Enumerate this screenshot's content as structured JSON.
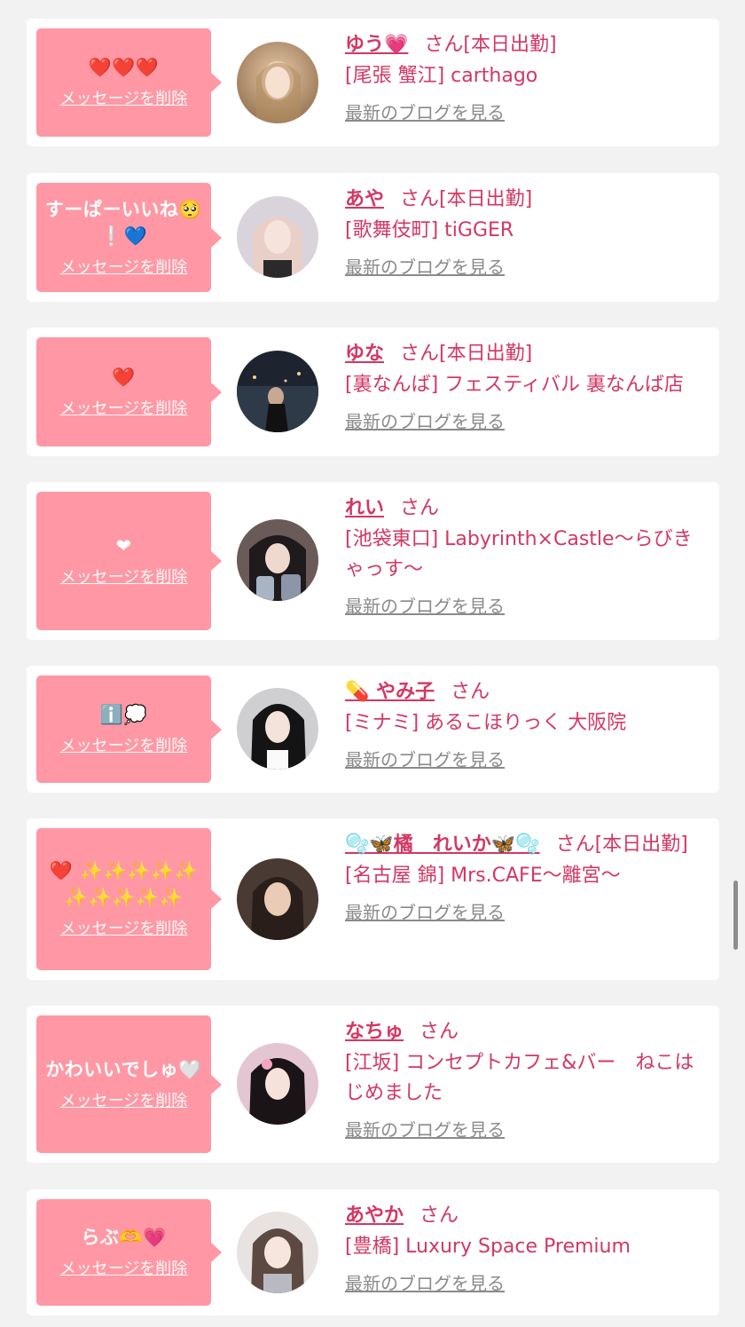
{
  "cards": [
    {
      "message": "❤️❤️❤️",
      "delete_label": "メッセージを削除",
      "name": "ゆう💗",
      "san": "さん",
      "status": "[本日出勤]",
      "shop": "[尾張 蟹江] carthago",
      "blog_label": "最新のブログを見る"
    },
    {
      "message": "すーぱーいいね🥺❕💙",
      "delete_label": "メッセージを削除",
      "name": "あや",
      "san": "さん",
      "status": "[本日出勤]",
      "shop": "[歌舞伎町] tiGGER",
      "blog_label": "最新のブログを見る"
    },
    {
      "message": "❤️",
      "delete_label": "メッセージを削除",
      "name": "ゆな",
      "san": "さん",
      "status": "[本日出勤]",
      "shop": "[裏なんば] フェスティバル 裏なんば店",
      "blog_label": "最新のブログを見る"
    },
    {
      "message": "❤",
      "delete_label": "メッセージを削除",
      "name": "れい",
      "san": "さん",
      "status": "",
      "shop": "[池袋東口] Labyrinth×Castle〜らびきゃっす〜",
      "blog_label": "最新のブログを見る"
    },
    {
      "message": "ℹ️💭",
      "delete_label": "メッセージを削除",
      "name": "💊 やみ子",
      "san": "さん",
      "status": "",
      "shop": "[ミナミ] あるこほりっく 大阪院",
      "blog_label": "最新のブログを見る"
    },
    {
      "message": "❤️ ✨✨✨✨✨✨✨✨✨✨",
      "delete_label": "メッセージを削除",
      "name": "🫧🦋橘　れいか🦋🫧",
      "san": "さん",
      "status": "[本日出勤]",
      "shop": "[名古屋 錦] Mrs.CAFE〜離宮〜",
      "blog_label": "最新のブログを見る"
    },
    {
      "message": "かわいいでしゅ🤍",
      "delete_label": "メッセージを削除",
      "name": "なちゅ",
      "san": "さん",
      "status": "",
      "shop": "[江坂] コンセプトカフェ&バー　ねこはじめました",
      "blog_label": "最新のブログを見る"
    },
    {
      "message": "らぶ🫶💗",
      "delete_label": "メッセージを削除",
      "name": "あやか",
      "san": "さん",
      "status": "",
      "shop": "[豊橋] Luxury Space Premium",
      "blog_label": "最新のブログを見る"
    }
  ],
  "colors": {
    "accent": "#d33763",
    "bubble": "#ff98a4",
    "muted": "#8a8a8a",
    "page_bg": "#f2f2f2"
  }
}
